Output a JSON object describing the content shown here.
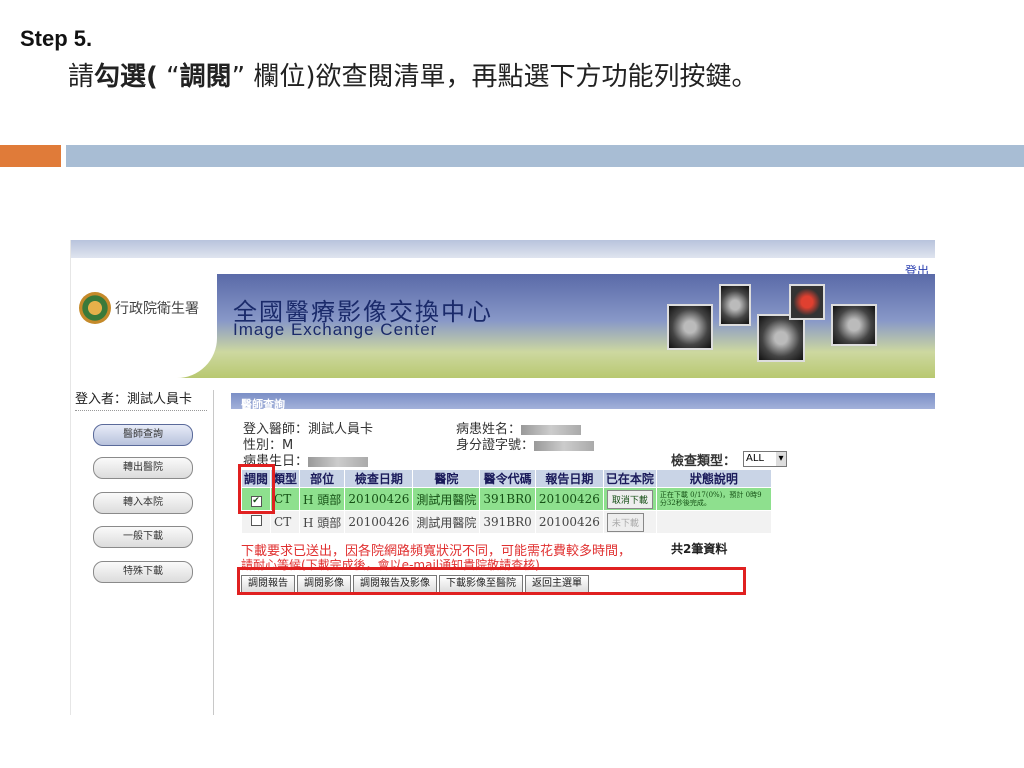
{
  "slide": {
    "step": "Step 5.",
    "instruction_pre": "請",
    "instruction_bold1": "勾選(",
    "instruction_quote_open": " “",
    "instruction_bold2": "調閱",
    "instruction_quote_close": "” ",
    "instruction_mid": "欄位)",
    "instruction_post": "欲查閱清單，再點選下方功能列按鍵。"
  },
  "colors": {
    "accent_orange": "#e07b39",
    "accent_blue": "#a8bdd4",
    "highlight_red": "#e02020"
  },
  "app": {
    "logout": "登出",
    "agency": "行政院衛生署",
    "title_cn": "全國醫療影像交換中心",
    "title_en": "Image Exchange Center",
    "login_user": "登入者：測試人員卡",
    "nav": [
      "醫師查詢",
      "轉出醫院",
      "轉入本院",
      "一般下載",
      "特殊下載"
    ],
    "panel_title": "醫師查詢",
    "doctor": "登入醫師：測試人員卡",
    "gender": "性別：M",
    "birth_label": "病患生日：",
    "patient_name_label": "病患姓名：",
    "id_label": "身分證字號：",
    "exam_type_label": "檢查類型：",
    "exam_type_value": "ALL",
    "table": {
      "headers": [
        "調閱",
        "類型",
        "部位",
        "檢查日期",
        "醫院",
        "醫令代碼",
        "報告日期",
        "已在本院",
        "狀態說明"
      ],
      "rows": [
        {
          "checked": "✔",
          "type": "CT",
          "site": "H 頭部",
          "exam_date": "20100426",
          "hospital": "測試用醫院",
          "code": "391BR0",
          "report_date": "20100426",
          "action": "取消下載",
          "status": "正在下載 0/17(0%)，預計 0時9分32秒後完成。"
        },
        {
          "checked": "",
          "type": "CT",
          "site": "H 頭部",
          "exam_date": "20100426",
          "hospital": "測試用醫院",
          "code": "391BR0",
          "report_date": "20100426",
          "action": "未下載",
          "status": ""
        }
      ]
    },
    "warning": "下載要求已送出，因各院網路頻寬狀況不同，可能需花費較多時間，",
    "warning2": "請耐心等候(下載完成後，會以e-mail通知貴院敬請查核)",
    "total": "共2筆資料",
    "functions": [
      "調閱報告",
      "調閱影像",
      "調閱報告及影像",
      "下載影像至醫院",
      "返回主選單"
    ]
  }
}
